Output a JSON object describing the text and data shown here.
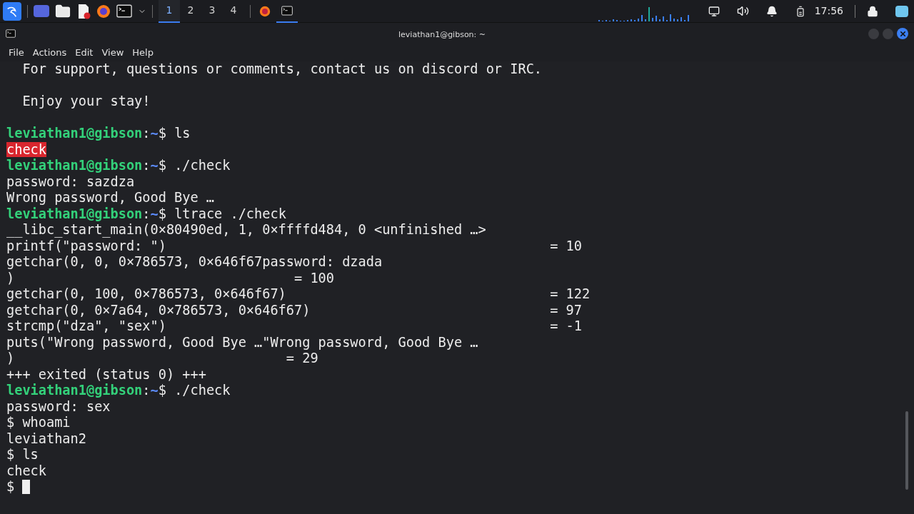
{
  "taskbar": {
    "workspaces": [
      {
        "label": "1",
        "selected": true
      },
      {
        "label": "2",
        "selected": false
      },
      {
        "label": "3",
        "selected": false
      },
      {
        "label": "4",
        "selected": false
      }
    ],
    "clock": "17:56"
  },
  "window": {
    "title": "leviathan1@gibson: ~"
  },
  "menu": [
    "File",
    "Actions",
    "Edit",
    "View",
    "Help"
  ],
  "terminal": {
    "lines": [
      {
        "kind": "output",
        "text": "  For support, questions or comments, contact us on discord or IRC."
      },
      {
        "kind": "blank"
      },
      {
        "kind": "output",
        "text": "  Enjoy your stay!"
      },
      {
        "kind": "blank"
      },
      {
        "kind": "prompt",
        "user": "leviathan1@gibson",
        "separator": ":",
        "path": "~",
        "sigil": "$",
        "command": "ls"
      },
      {
        "kind": "file",
        "text": "check"
      },
      {
        "kind": "prompt",
        "user": "leviathan1@gibson",
        "separator": ":",
        "path": "~",
        "sigil": "$",
        "command": "./check"
      },
      {
        "kind": "output",
        "text": "password: sazdza"
      },
      {
        "kind": "output",
        "text": "Wrong password, Good Bye …"
      },
      {
        "kind": "prompt",
        "user": "leviathan1@gibson",
        "separator": ":",
        "path": "~",
        "sigil": "$",
        "command": "ltrace ./check"
      },
      {
        "kind": "output",
        "text": "__libc_start_main(0×80490ed, 1, 0×ffffd484, 0 <unfinished …>"
      },
      {
        "kind": "output",
        "text": "printf(\"password: \")                                                = 10"
      },
      {
        "kind": "output",
        "text": "getchar(0, 0, 0×786573, 0×646f67password: dzada"
      },
      {
        "kind": "output",
        "text": ")                                   = 100"
      },
      {
        "kind": "output",
        "text": "getchar(0, 100, 0×786573, 0×646f67)                                 = 122"
      },
      {
        "kind": "output",
        "text": "getchar(0, 0×7a64, 0×786573, 0×646f67)                              = 97"
      },
      {
        "kind": "output",
        "text": "strcmp(\"dza\", \"sex\")                                                = -1"
      },
      {
        "kind": "output",
        "text": "puts(\"Wrong password, Good Bye …\"Wrong password, Good Bye …"
      },
      {
        "kind": "output",
        "text": ")                                  = 29"
      },
      {
        "kind": "output",
        "text": "+++ exited (status 0) +++"
      },
      {
        "kind": "prompt",
        "user": "leviathan1@gibson",
        "separator": ":",
        "path": "~",
        "sigil": "$",
        "command": "./check"
      },
      {
        "kind": "output",
        "text": "password: sex"
      },
      {
        "kind": "output",
        "text": "$ whoami"
      },
      {
        "kind": "output",
        "text": "leviathan2"
      },
      {
        "kind": "output",
        "text": "$ ls"
      },
      {
        "kind": "output",
        "text": "check"
      },
      {
        "kind": "input",
        "text": "$ "
      }
    ]
  }
}
